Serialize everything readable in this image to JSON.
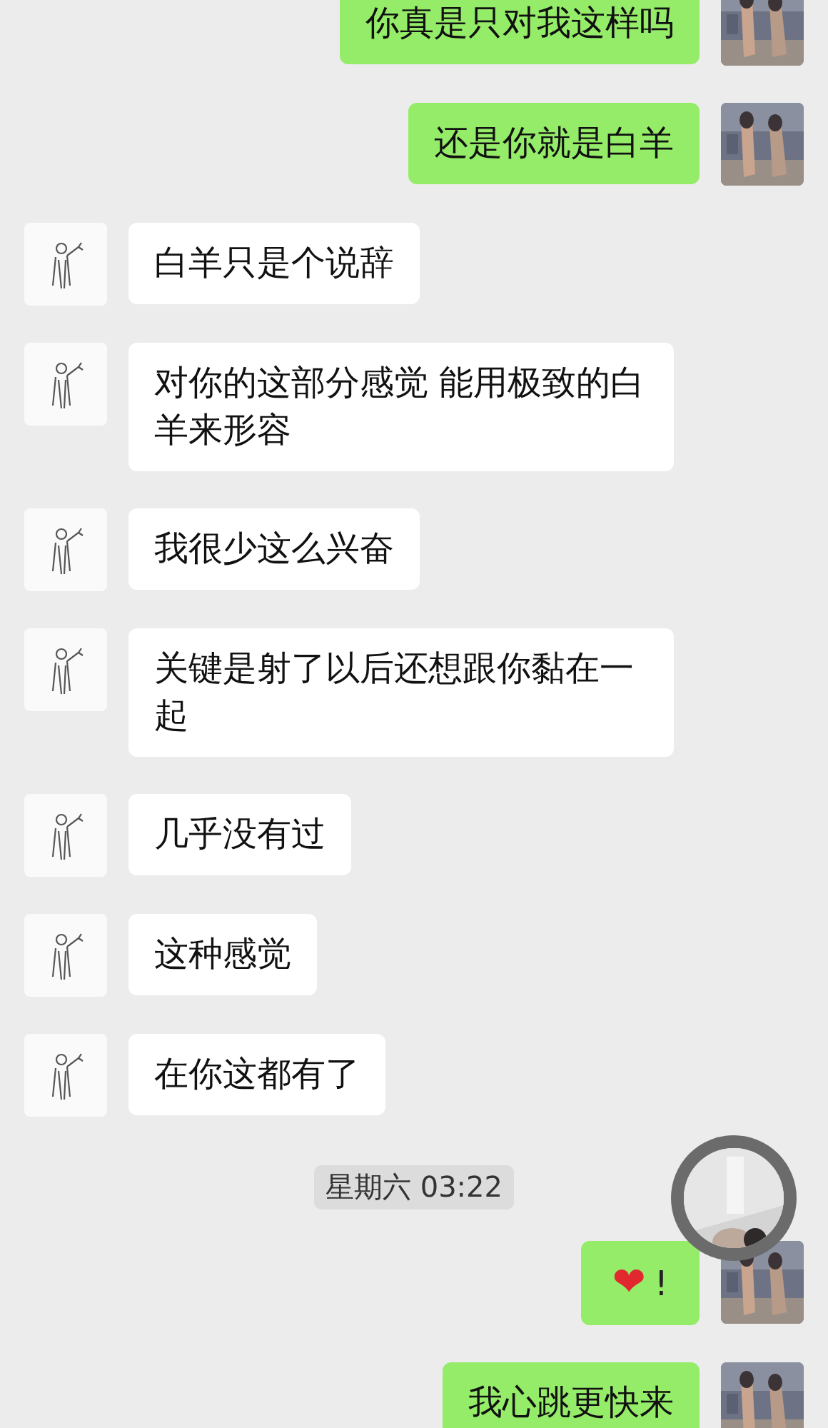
{
  "messages": [
    {
      "kind": "sent",
      "text": "你真是只对我这样吗"
    },
    {
      "kind": "sent",
      "text": "还是你就是白羊"
    },
    {
      "kind": "received",
      "text": "白羊只是个说辞"
    },
    {
      "kind": "received",
      "text": "对你的这部分感觉 能用极致的白羊来形容"
    },
    {
      "kind": "received",
      "text": "我很少这么兴奋"
    },
    {
      "kind": "received",
      "text": "关键是射了以后还想跟你黏在一起"
    },
    {
      "kind": "received",
      "text": "几乎没有过"
    },
    {
      "kind": "received",
      "text": "这种感觉"
    },
    {
      "kind": "received",
      "text": "在你这都有了"
    },
    {
      "kind": "time",
      "text": "星期六 03:22"
    },
    {
      "kind": "sent",
      "emoji": "❤",
      "text": "!"
    },
    {
      "kind": "sent",
      "text": "我心跳更快来"
    }
  ]
}
